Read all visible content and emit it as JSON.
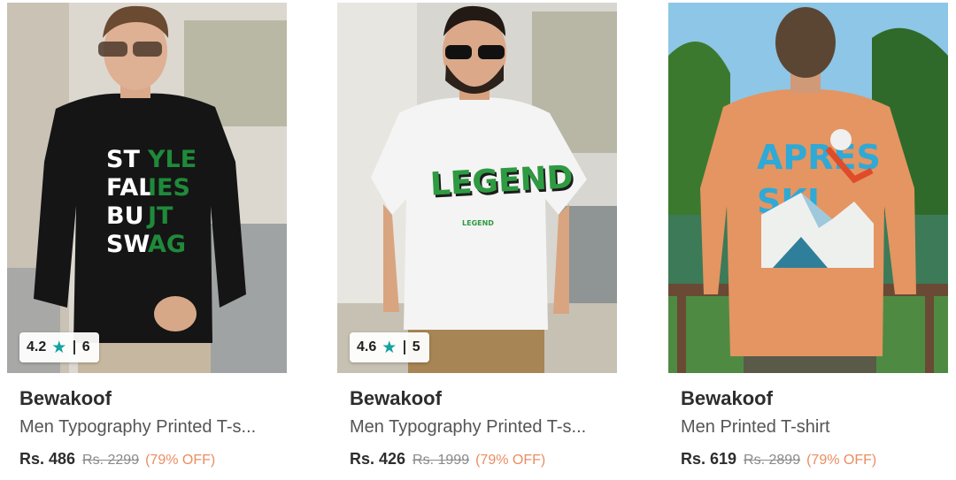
{
  "products": [
    {
      "brand": "Bewakoof",
      "title": "Men Typography Printed T-s...",
      "price": "Rs. 486",
      "mrp": "Rs. 2299",
      "discount": "(79% OFF)",
      "rating": "4.2",
      "rating_count": "6",
      "shirt_print": [
        "ST'YLE",
        "FAL'IES",
        "BU'T",
        "SW'AG"
      ],
      "colors": {
        "shirt": "#151515",
        "print_white": "#ffffff",
        "print_green": "#1f8a3a"
      }
    },
    {
      "brand": "Bewakoof",
      "title": "Men Typography Printed T-s...",
      "price": "Rs. 426",
      "mrp": "Rs. 1999",
      "discount": "(79% OFF)",
      "rating": "4.6",
      "rating_count": "5",
      "shirt_print": [
        "LEGEND"
      ],
      "colors": {
        "shirt": "#f4f4f4",
        "print_green": "#2e9a42"
      }
    },
    {
      "brand": "Bewakoof",
      "title": "Men Printed T-shirt",
      "price": "Rs. 619",
      "mrp": "Rs. 2899",
      "discount": "(79% OFF)",
      "shirt_print": [
        "APRÈS",
        "SKI"
      ],
      "colors": {
        "shirt": "#e49562",
        "print_blue": "#2fa9d6"
      }
    }
  ],
  "icons": {
    "star": "star-icon"
  },
  "colors": {
    "star": "#12a39f",
    "discount": "#e98d63",
    "text": "#2d2d2d",
    "mrp": "#8a8a8a"
  }
}
